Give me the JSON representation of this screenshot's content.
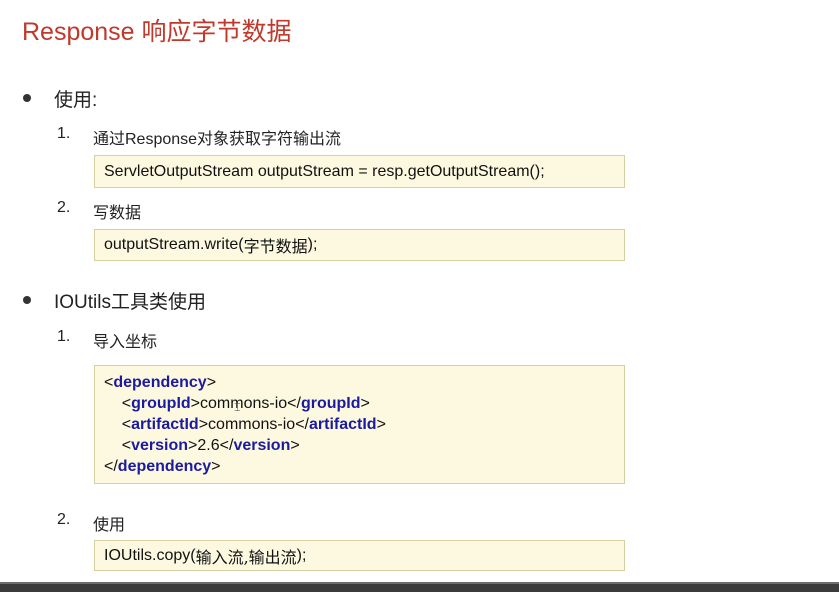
{
  "slide": {
    "title": "Response 响应字节数据",
    "section1": {
      "label": "使用:",
      "step1": {
        "num": "1.",
        "text": "通过Response对象获取字符输出流",
        "code": "ServletOutputStream outputStream = resp.getOutputStream();"
      },
      "step2": {
        "num": "2.",
        "text": "写数据",
        "code_pre": "outputStream.write(",
        "code_cjk": "字节数据",
        "code_post": ");"
      }
    },
    "section2": {
      "label": "IOUtils工具类使用",
      "step1": {
        "num": "1.",
        "text": "导入坐标",
        "xml": {
          "dependency": "dependency",
          "groupId_tag": "groupId",
          "groupId_val": "commons-io",
          "artifactId_tag": "artifactId",
          "artifactId_val": "commons-io",
          "version_tag": "version",
          "version_val": "2.6"
        }
      },
      "step2": {
        "num": "2.",
        "text": "使用",
        "code_pre": "IOUtils.copy(",
        "code_cjk": "输入流,输出流",
        "code_post": ");"
      }
    }
  },
  "colors": {
    "title": "#c0392b",
    "xml_tag": "#1b1ba0",
    "code_bg": "#fdf9e1",
    "code_border": "#d6cf9f"
  }
}
